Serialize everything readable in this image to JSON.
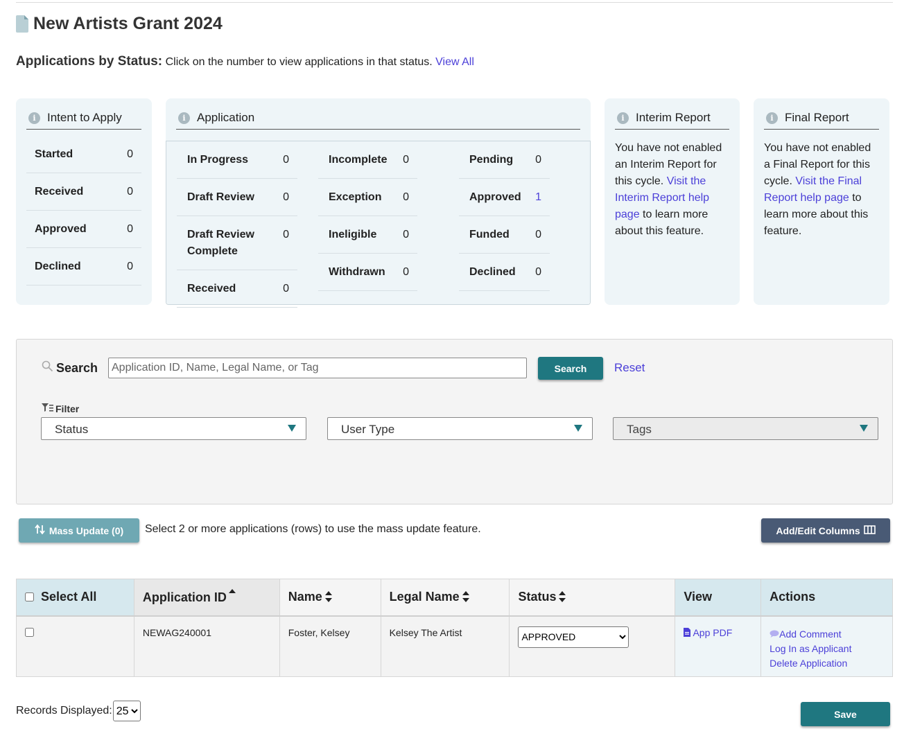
{
  "page": {
    "title": "New Artists Grant 2024"
  },
  "status_header": {
    "heading": "Applications by Status:",
    "instruction": "Click on the number to view applications in that status.",
    "view_all": "View All"
  },
  "cards": {
    "intent": {
      "title": "Intent to Apply",
      "rows": [
        {
          "label": "Started",
          "count": "0"
        },
        {
          "label": "Received",
          "count": "0"
        },
        {
          "label": "Approved",
          "count": "0"
        },
        {
          "label": "Declined",
          "count": "0"
        }
      ]
    },
    "application": {
      "title": "Application",
      "col1": [
        {
          "label": "In Progress",
          "count": "0"
        },
        {
          "label": "Draft Review",
          "count": "0"
        },
        {
          "label": "Draft Review Complete",
          "count": "0"
        },
        {
          "label": "Received",
          "count": "0"
        }
      ],
      "col2": [
        {
          "label": "Incomplete",
          "count": "0"
        },
        {
          "label": "Exception",
          "count": "0"
        },
        {
          "label": "Ineligible",
          "count": "0"
        },
        {
          "label": "Withdrawn",
          "count": "0"
        }
      ],
      "col3": [
        {
          "label": "Pending",
          "count": "0"
        },
        {
          "label": "Approved",
          "count": "1"
        },
        {
          "label": "Funded",
          "count": "0"
        },
        {
          "label": "Declined",
          "count": "0"
        }
      ]
    },
    "interim": {
      "title": "Interim Report",
      "text_before": "You have not enabled an Interim Report for this cycle.",
      "link": "Visit the Interim Report help page",
      "text_after": "to learn more about this feature."
    },
    "final": {
      "title": "Final Report",
      "text_before": "You have not enabled a Final Report for this cycle.",
      "link": "Visit the Final Report help page",
      "text_after": "to learn more about this feature."
    }
  },
  "search": {
    "label": "Search",
    "placeholder": "Application ID, Name, Legal Name, or Tag",
    "button": "Search",
    "reset": "Reset",
    "filter_label": "Filter",
    "filters": [
      {
        "label": "Status",
        "disabled": false
      },
      {
        "label": "User Type",
        "disabled": false
      },
      {
        "label": "Tags",
        "disabled": true
      }
    ]
  },
  "toolbar": {
    "mass_update": "Mass Update (0)",
    "mass_update_hint": "Select 2 or more applications (rows) to use the mass update feature.",
    "add_edit_columns": "Add/Edit Columns"
  },
  "table": {
    "headers": {
      "select_all": "Select All",
      "application_id": "Application ID",
      "name": "Name",
      "legal_name": "Legal Name",
      "status": "Status",
      "view": "View",
      "actions": "Actions"
    },
    "rows": [
      {
        "application_id": "NEWAG240001",
        "name": "Foster, Kelsey",
        "legal_name": "Kelsey The Artist",
        "status": "APPROVED",
        "view": "App PDF",
        "actions": [
          "Add Comment",
          "Log In as Applicant",
          "Delete Application"
        ]
      }
    ]
  },
  "footer": {
    "records_label": "Records Displayed:",
    "records_value": "25",
    "save": "Save"
  },
  "colors": {
    "accent_teal": "#1f7780",
    "link": "#4b3fd8",
    "card_bg": "#eef5f8",
    "columns_button": "#495a75"
  },
  "icons": [
    "document-icon",
    "info-icon",
    "search-icon",
    "filter-icon",
    "mass-update-icon",
    "columns-icon",
    "sort-icon",
    "pdf-icon",
    "comment-icon"
  ]
}
